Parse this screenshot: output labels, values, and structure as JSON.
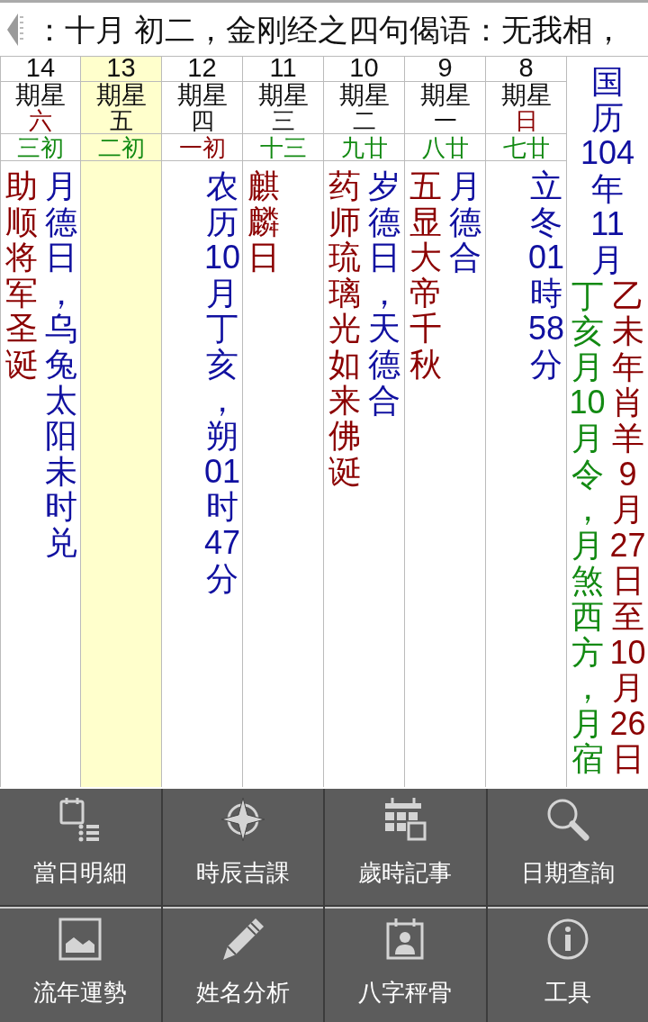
{
  "marquee": {
    "text": "：十月 初二，金刚经之四句偈语：无我相，"
  },
  "days": [
    {
      "day": "14",
      "weekday_label": "期星",
      "weekday": {
        "text": "六",
        "color": "#8b0000"
      },
      "lunar": {
        "text": "三初",
        "color": "#138a13"
      },
      "selected": false,
      "festival": "助顺将军圣诞",
      "almanac": "月德日，乌兔太阳未时兑"
    },
    {
      "day": "13",
      "weekday_label": "期星",
      "weekday": {
        "text": "五",
        "color": "#111111"
      },
      "lunar": {
        "text": "二初",
        "color": "#138a13"
      },
      "selected": true
    },
    {
      "day": "12",
      "weekday_label": "期星",
      "weekday": {
        "text": "四",
        "color": "#111111"
      },
      "lunar": {
        "text": "一初",
        "color": "#8b0000"
      },
      "selected": false,
      "almanac": "农历10月丁亥，朔01时47分"
    },
    {
      "day": "11",
      "weekday_label": "期星",
      "weekday": {
        "text": "三",
        "color": "#111111"
      },
      "lunar": {
        "text": "十三",
        "color": "#138a13"
      },
      "selected": false,
      "festival": "麒麟日"
    },
    {
      "day": "10",
      "weekday_label": "期星",
      "weekday": {
        "text": "二",
        "color": "#111111"
      },
      "lunar": {
        "text": "九廿",
        "color": "#138a13"
      },
      "selected": false,
      "festival": "药师琉璃光如来佛诞",
      "almanac": "岁德日，天德合"
    },
    {
      "day": "9",
      "weekday_label": "期星",
      "weekday": {
        "text": "一",
        "color": "#111111"
      },
      "lunar": {
        "text": "八廿",
        "color": "#138a13"
      },
      "selected": false,
      "festival": "五显大帝千秋",
      "almanac": "月德合"
    },
    {
      "day": "8",
      "weekday_label": "期星",
      "weekday": {
        "text": "日",
        "color": "#8b0000"
      },
      "lunar": {
        "text": "七廿",
        "color": "#138a13"
      },
      "selected": false,
      "almanac": "立冬01時58分"
    }
  ],
  "month_column": {
    "title": "国历104年11月",
    "month_note": "丁亥月10月令，月煞西方，月宿",
    "year_note": "乙未年肖羊9月27日至10月26日"
  },
  "menu": [
    {
      "label": "當日明細"
    },
    {
      "label": "時辰吉課"
    },
    {
      "label": "歲時記事"
    },
    {
      "label": "日期查詢"
    },
    {
      "label": "流年運勢"
    },
    {
      "label": "姓名分析"
    },
    {
      "label": "八字秤骨"
    },
    {
      "label": "工具"
    }
  ]
}
